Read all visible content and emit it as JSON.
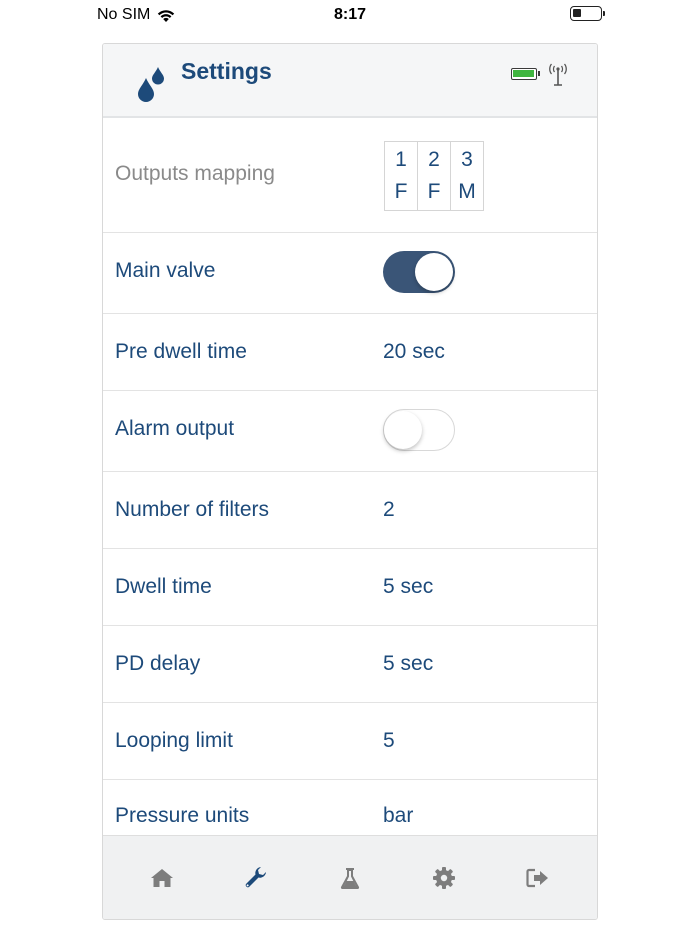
{
  "status_bar": {
    "carrier": "No SIM",
    "time": "8:17"
  },
  "header": {
    "title": "Settings",
    "logo_icon": "water-drops-icon",
    "battery_icon": "battery-full-icon",
    "signal_icon": "antenna-signal-icon"
  },
  "colors": {
    "primary": "#1d4a7a",
    "toggle_on": "#3a5577",
    "battery_green": "#3fb53f",
    "muted_label": "#8a8a8a"
  },
  "settings": {
    "outputs_mapping": {
      "label": "Outputs mapping",
      "cells": [
        {
          "top": "1",
          "bottom": "F"
        },
        {
          "top": "2",
          "bottom": "F"
        },
        {
          "top": "3",
          "bottom": "M"
        }
      ]
    },
    "main_valve": {
      "label": "Main valve",
      "state": "on"
    },
    "pre_dwell_time": {
      "label": "Pre dwell time",
      "value": "20 sec"
    },
    "alarm_output": {
      "label": "Alarm output",
      "state": "off"
    },
    "number_of_filters": {
      "label": "Number of filters",
      "value": "2"
    },
    "dwell_time": {
      "label": "Dwell time",
      "value": "5 sec"
    },
    "pd_delay": {
      "label": "PD delay",
      "value": "5 sec"
    },
    "looping_limit": {
      "label": "Looping limit",
      "value": "5"
    },
    "pressure_units": {
      "label": "Pressure units",
      "value": "bar"
    }
  },
  "tabbar": {
    "items": [
      {
        "icon": "home-icon",
        "active": false
      },
      {
        "icon": "wrench-icon",
        "active": true
      },
      {
        "icon": "flask-icon",
        "active": false
      },
      {
        "icon": "gear-icon",
        "active": false
      },
      {
        "icon": "logout-icon",
        "active": false
      }
    ]
  }
}
